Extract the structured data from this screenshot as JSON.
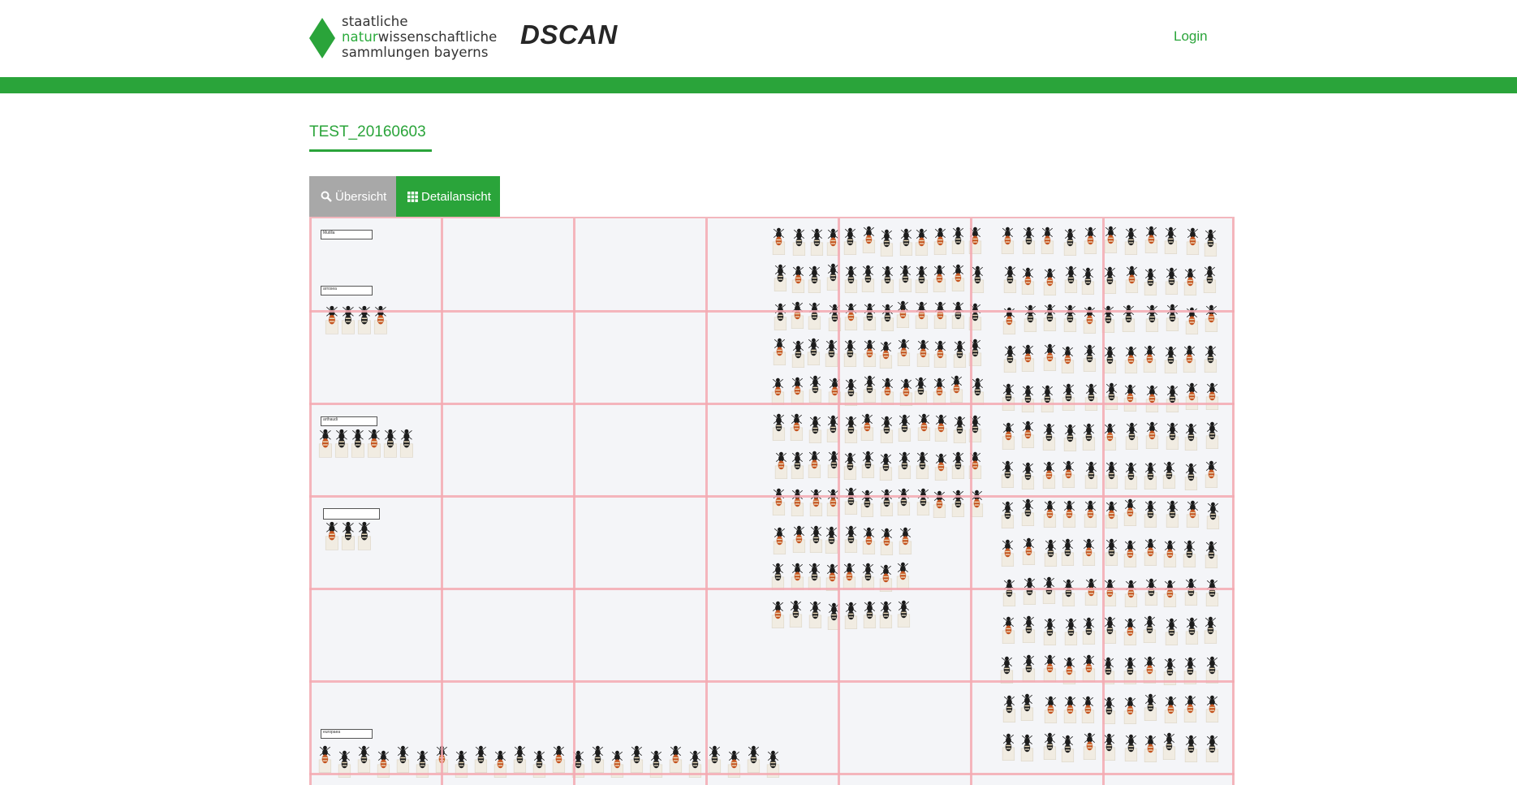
{
  "header": {
    "logo": {
      "line1": "staatliche",
      "line2_highlight": "natur",
      "line2_rest": "wissenschaftliche",
      "line3": "sammlungen bayerns"
    },
    "brand": "DSCAN",
    "login_label": "Login"
  },
  "page": {
    "title": "TEST_20160603"
  },
  "tabs": [
    {
      "label": "Übersicht",
      "icon": "search-icon",
      "active": false
    },
    {
      "label": "Detailansicht",
      "icon": "grid-icon",
      "active": true
    }
  ],
  "viewer": {
    "grid": {
      "cols": 7,
      "rows": 7
    },
    "tray_labels": [
      "Mutilla",
      "arrosea",
      "arthaudi",
      "europaea"
    ]
  },
  "colors": {
    "accent": "#2aa43a",
    "tab_inactive": "#a8a8a8",
    "grid_line": "#f3a9b1",
    "tray_bg": "#f4f5f8"
  }
}
